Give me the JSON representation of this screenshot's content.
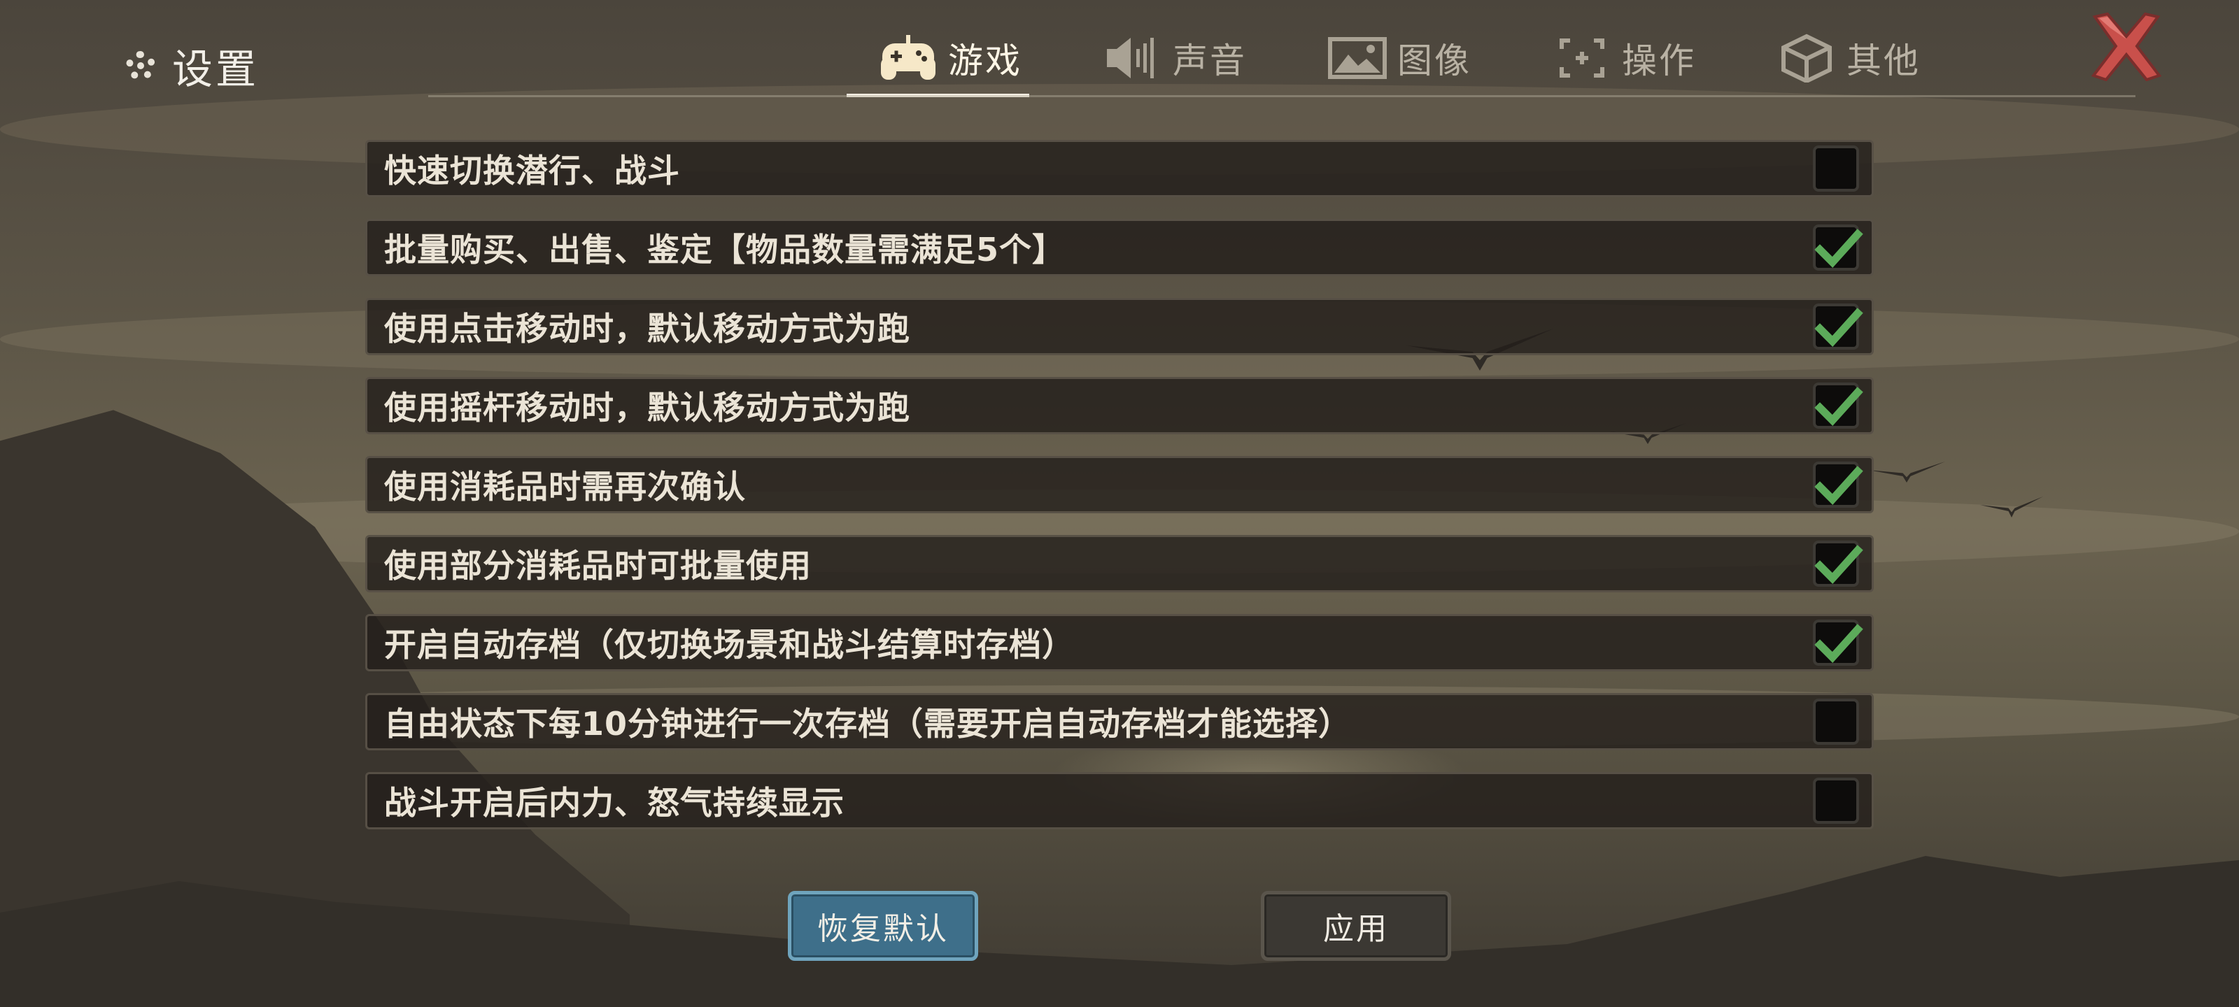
{
  "header": {
    "title": "设置",
    "tabs": [
      {
        "label": "游戏",
        "icon": "gamepad-icon",
        "active": true
      },
      {
        "label": "声音",
        "icon": "speaker-icon",
        "active": false
      },
      {
        "label": "图像",
        "icon": "image-icon",
        "active": false
      },
      {
        "label": "操作",
        "icon": "controls-icon",
        "active": false
      },
      {
        "label": "其他",
        "icon": "cube-icon",
        "active": false
      }
    ],
    "close_icon": "close-icon"
  },
  "options": [
    {
      "label": "快速切换潜行、战斗",
      "checked": false
    },
    {
      "label": "批量购买、出售、鉴定【物品数量需满足5个】",
      "checked": true
    },
    {
      "label": "使用点击移动时，默认移动方式为跑",
      "checked": true
    },
    {
      "label": "使用摇杆移动时，默认移动方式为跑",
      "checked": true
    },
    {
      "label": "使用消耗品时需再次确认",
      "checked": true
    },
    {
      "label": "使用部分消耗品时可批量使用",
      "checked": true
    },
    {
      "label": "开启自动存档（仅切换场景和战斗结算时存档）",
      "checked": true
    },
    {
      "label": "自由状态下每10分钟进行一次存档（需要开启自动存档才能选择）",
      "checked": false
    },
    {
      "label": "战斗开启后内力、怒气持续显示",
      "checked": false
    }
  ],
  "buttons": {
    "reset_label": "恢复默认",
    "apply_label": "应用"
  },
  "colors": {
    "check": "#5cab5a",
    "reset_button": "#3e6f8a",
    "close_x": "#c9504b"
  }
}
